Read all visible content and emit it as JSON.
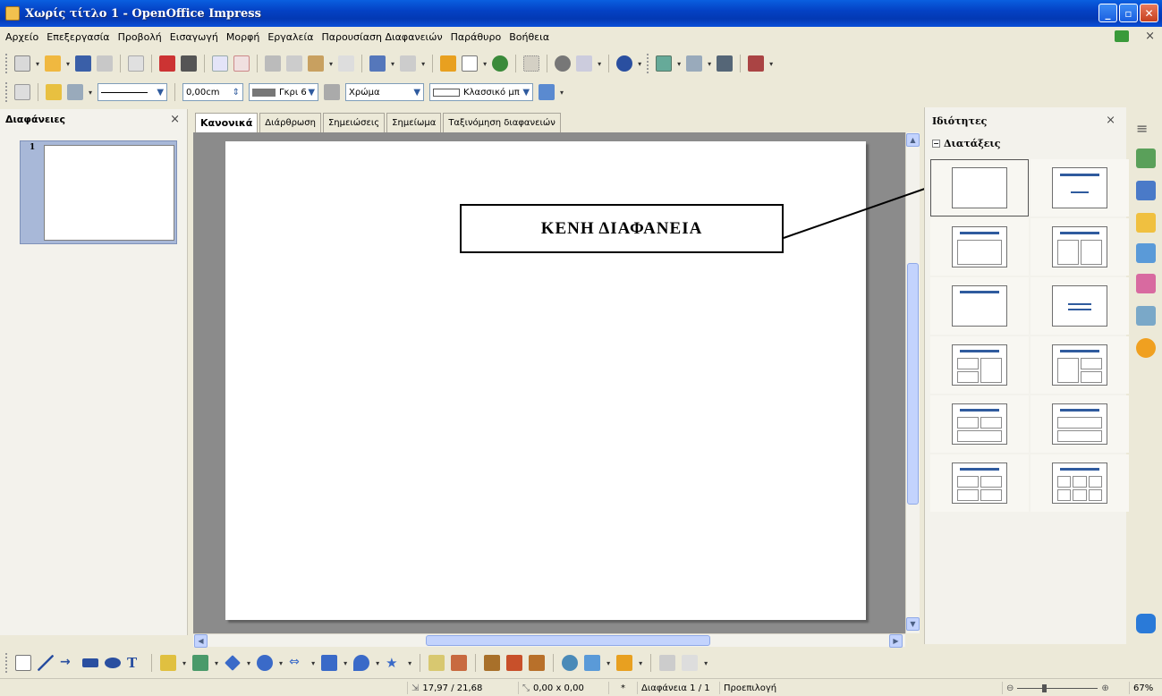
{
  "window": {
    "title": "Χωρίς τίτλο 1 - OpenOffice Impress"
  },
  "menu": [
    "Αρχείο",
    "Επεξεργασία",
    "Προβολή",
    "Εισαγωγή",
    "Μορφή",
    "Εργαλεία",
    "Παρουσίαση Διαφανειών",
    "Παράθυρο",
    "Βοήθεια"
  ],
  "line_toolbar": {
    "line_width": "0,00cm",
    "line_color": "Γκρι 6",
    "area_style": "Χρώμα",
    "area_fill": "Κλασσικό μπ"
  },
  "slides_panel": {
    "title": "Διαφάνειες",
    "slide_number": "1"
  },
  "view_tabs": [
    "Κανονικά",
    "Διάρθρωση",
    "Σημειώσεις",
    "Σημείωμα",
    "Ταξινόμηση διαφανειών"
  ],
  "properties": {
    "title": "Ιδιότητες",
    "section": "Διατάξεις"
  },
  "callout": "ΚΕΝΗ ΔΙΑΦΑΝΕΙΑ",
  "status": {
    "position": "17,97 / 21,68",
    "size": "0,00 x 0,00",
    "modified": "*",
    "slide": "Διαφάνεια 1 / 1",
    "layout_name": "Προεπιλογή",
    "zoom": "67%"
  },
  "colors": {
    "titlebar": "#0441c4",
    "accent": "#2f5b9e",
    "scrollbar": "#c3d3fd"
  }
}
